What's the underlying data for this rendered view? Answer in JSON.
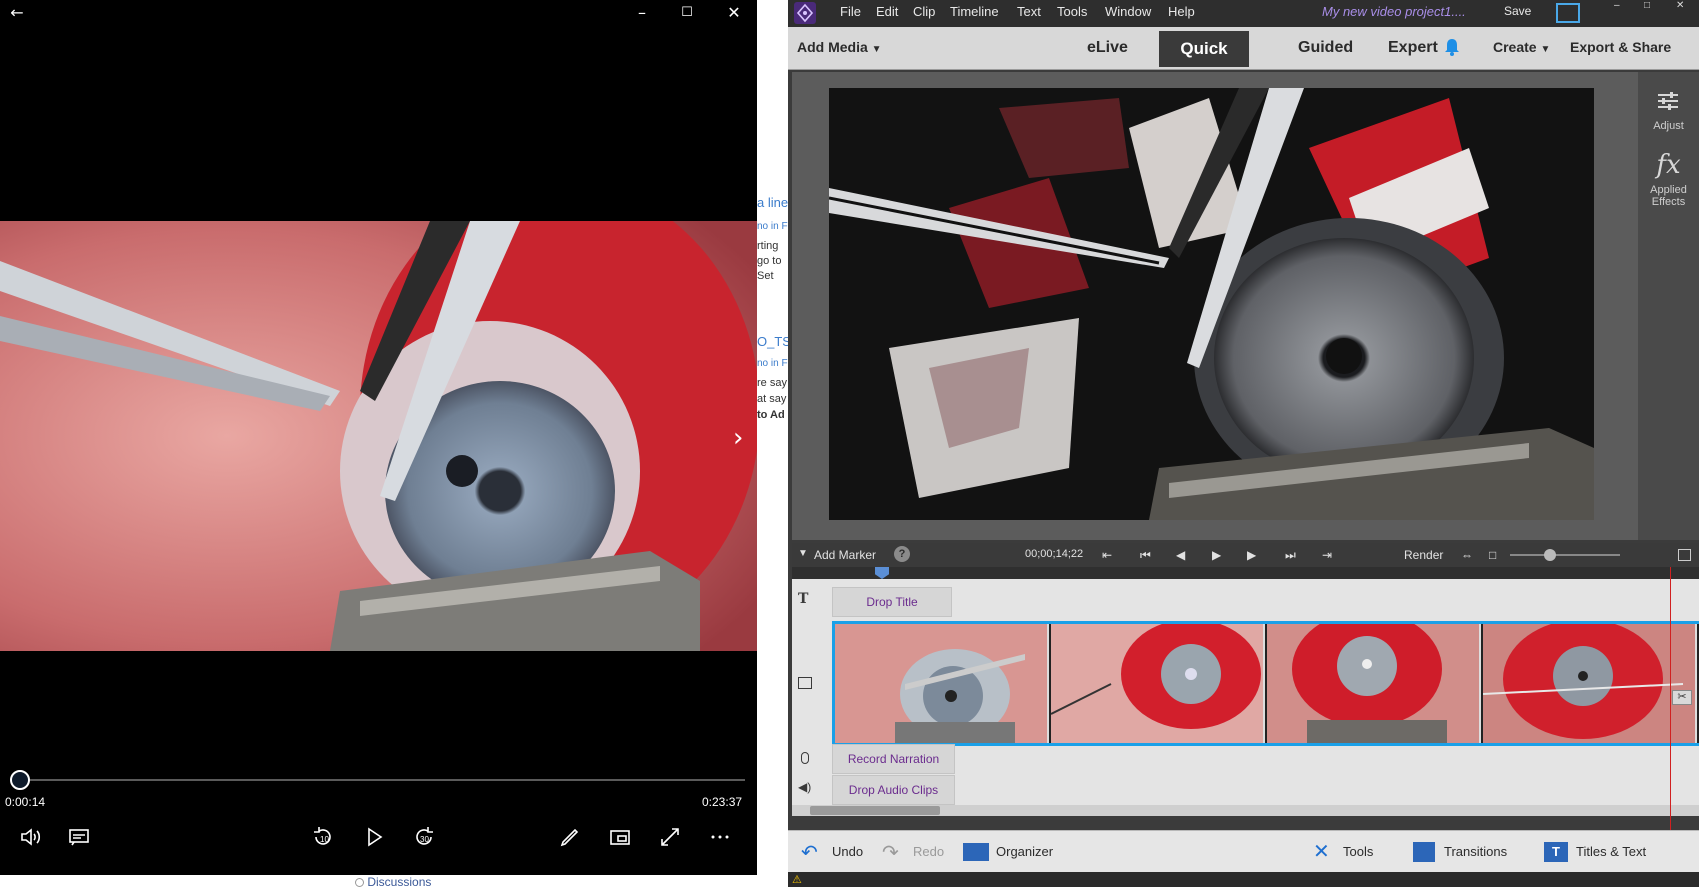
{
  "player": {
    "current_time": "0:00:14",
    "total_time": "0:23:37",
    "progress_fraction": 0.01,
    "seek_back_label": "10",
    "seek_forward_label": "30",
    "icons": [
      "back-arrow-icon",
      "minimize-icon",
      "maximize-icon",
      "close-icon",
      "volume-icon",
      "subtitles-icon",
      "rewind-10-icon",
      "play-icon",
      "forward-30-icon",
      "pen-icon",
      "miniview-icon",
      "fullscreen-icon",
      "more-icon",
      "next-chevron-icon"
    ]
  },
  "webstrip": {
    "fragments": [
      "a line",
      "no in F",
      "rting",
      "go to",
      "Set",
      "O_TS",
      "no in F",
      "re say",
      "at say",
      "to Ad"
    ],
    "discussions_link": "Discussions"
  },
  "premiere": {
    "menu": [
      "File",
      "Edit",
      "Clip",
      "Timeline",
      "Text",
      "Tools",
      "Window",
      "Help"
    ],
    "project_title": "My new video project1....",
    "save_label": "Save",
    "add_media_label": "Add Media",
    "modes": {
      "elive": "eLive",
      "quick": "Quick",
      "guided": "Guided",
      "expert": "Expert"
    },
    "create_label": "Create",
    "export_label": "Export & Share",
    "side": {
      "adjust": "Adjust",
      "applied_effects": "Applied Effects"
    },
    "controls": {
      "add_marker": "Add Marker",
      "help": "?",
      "timecode": "00;00;14;22",
      "render": "Render"
    },
    "timeline": {
      "title_track": "Drop Title",
      "narration_track": "Record Narration",
      "audio_track": "Drop Audio Clips"
    },
    "bottom": {
      "undo": "Undo",
      "redo": "Redo",
      "organizer": "Organizer",
      "tools": "Tools",
      "transitions": "Transitions",
      "titles_text": "Titles & Text"
    },
    "accent_color": "#1aa0e8",
    "track_text_color": "#6b2c8e"
  }
}
